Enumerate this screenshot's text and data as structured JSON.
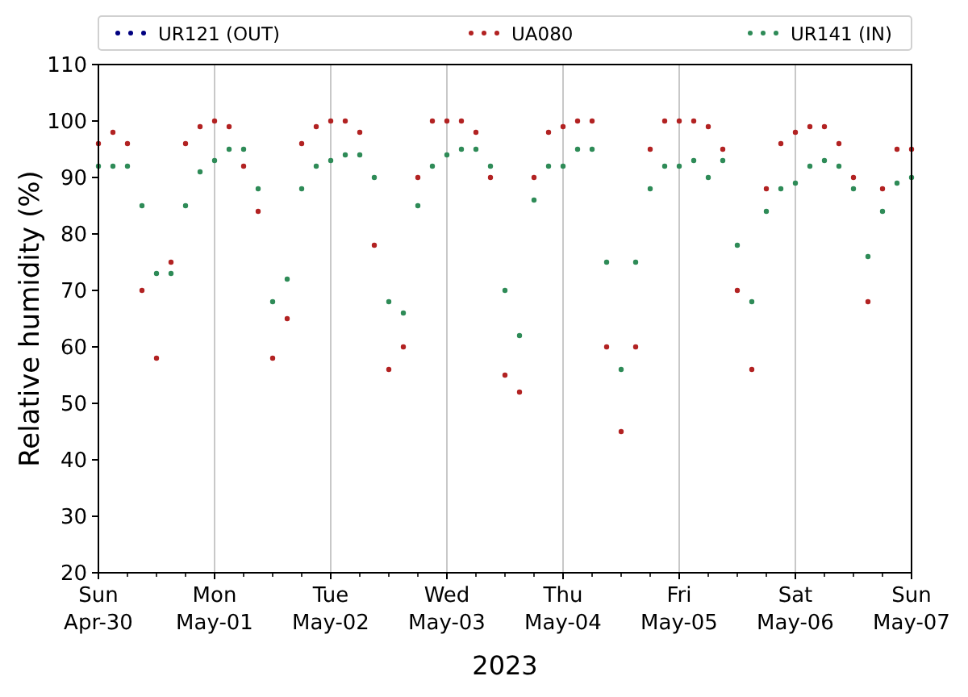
{
  "chart_data": {
    "type": "scatter",
    "grid": true,
    "legend": "top",
    "ylabel": "Relative humidity (%)",
    "xlabel": "2023",
    "categories": [
      "Sun\nApr-30",
      null,
      null,
      null,
      null,
      null,
      null,
      null,
      "Mon\nMay-01",
      null,
      null,
      null,
      null,
      null,
      null,
      null,
      "Tue\nMay-02",
      null,
      null,
      null,
      null,
      null,
      null,
      null,
      "Wed\nMay-03",
      null,
      null,
      null,
      null,
      null,
      null,
      null,
      "Thu\nMay-04",
      null,
      null,
      null,
      null,
      null,
      null,
      null,
      "Fri\nMay-05",
      null,
      null,
      null,
      null,
      null,
      null,
      null,
      "Sat\nMay-06",
      null,
      null,
      null,
      null,
      null,
      null,
      null,
      "Sun\nMay-07"
    ],
    "ylim": [
      20,
      110
    ],
    "yticks": [
      20,
      30,
      40,
      50,
      60,
      70,
      80,
      90,
      100,
      110
    ],
    "series": [
      {
        "name": "UR121 (OUT)",
        "color": "#000080",
        "values": [
          null,
          null,
          null,
          null,
          null,
          null,
          null,
          null,
          null,
          null,
          null,
          null,
          null,
          null,
          null,
          null,
          null,
          null,
          null,
          null,
          null,
          null,
          null,
          null,
          null,
          null,
          null,
          null,
          null,
          null,
          null,
          null,
          null,
          null,
          null,
          null,
          null,
          null,
          null,
          null,
          null,
          null,
          null,
          null,
          null,
          null,
          null,
          null,
          null,
          null,
          null,
          null,
          null,
          null,
          null,
          null,
          null
        ]
      },
      {
        "name": "UA080",
        "color": "#b22222",
        "values": [
          96,
          98,
          96,
          70,
          58,
          75,
          96,
          99,
          100,
          99,
          92,
          84,
          58,
          65,
          96,
          99,
          100,
          100,
          98,
          78,
          56,
          60,
          90,
          100,
          100,
          100,
          98,
          90,
          55,
          52,
          90,
          98,
          99,
          100,
          100,
          60,
          45,
          60,
          95,
          100,
          100,
          100,
          99,
          95,
          70,
          56,
          88,
          96,
          98,
          99,
          99,
          96,
          90,
          68,
          88,
          95,
          95
        ]
      },
      {
        "name": "UR141 (IN)",
        "color": "#2e8b57",
        "values": [
          92,
          92,
          92,
          85,
          73,
          73,
          85,
          91,
          93,
          95,
          95,
          88,
          68,
          72,
          88,
          92,
          93,
          94,
          94,
          90,
          68,
          66,
          85,
          92,
          94,
          95,
          95,
          92,
          70,
          62,
          86,
          92,
          92,
          95,
          95,
          75,
          56,
          75,
          88,
          92,
          92,
          93,
          90,
          93,
          78,
          68,
          84,
          88,
          89,
          92,
          93,
          92,
          88,
          76,
          84,
          89,
          90
        ]
      }
    ]
  }
}
